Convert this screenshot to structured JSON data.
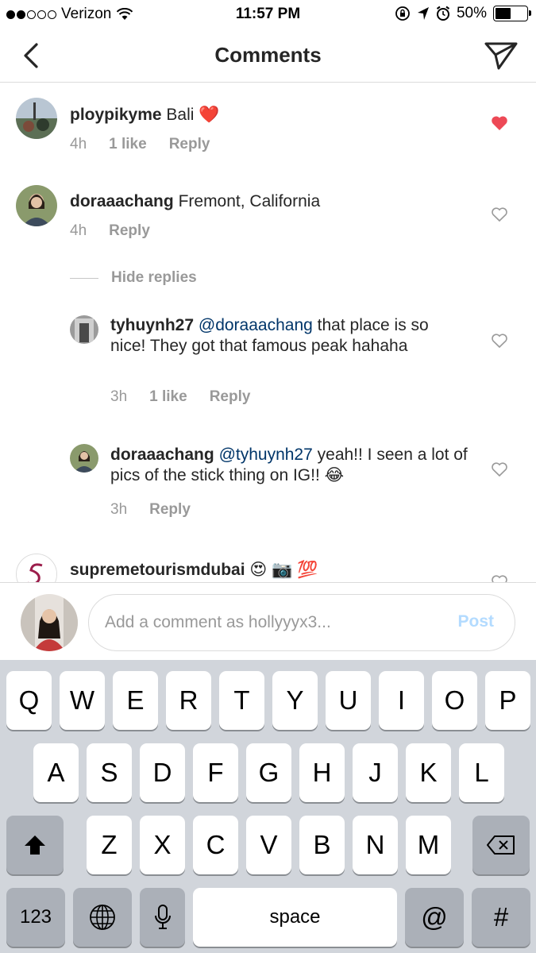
{
  "status": {
    "carrier": "Verizon",
    "time": "11:57 PM",
    "battery": "50%",
    "battery_level": 0.5
  },
  "nav": {
    "title": "Comments",
    "back_icon": "chevron-left-icon",
    "share_icon": "paper-plane-icon"
  },
  "comments": [
    {
      "user": "ploypikyme",
      "text": "Bali ❤️",
      "time": "4h",
      "likes": "1 like",
      "reply": "Reply",
      "liked": true
    },
    {
      "user": "doraaachang",
      "text": "Fremont, California",
      "time": "4h",
      "reply": "Reply",
      "liked": false
    },
    {
      "user": "supremetourismdubai",
      "text": "😍 📷 💯"
    }
  ],
  "hide_replies": "Hide replies",
  "replies": [
    {
      "user": "tyhuynh27",
      "mention": "@doraaachang",
      "text": "that place is so nice! They got that famous peak hahaha",
      "time": "3h",
      "likes": "1 like",
      "reply": "Reply"
    },
    {
      "user": "doraaachang",
      "mention": "@tyhuynh27",
      "text": "yeah!! I seen a lot of pics of the stick thing on IG!! 😂",
      "time": "3h",
      "reply": "Reply"
    }
  ],
  "input": {
    "placeholder": "Add a comment as hollyyyx3...",
    "post": "Post"
  },
  "keyboard": {
    "row1": [
      "Q",
      "W",
      "E",
      "R",
      "T",
      "Y",
      "U",
      "I",
      "O",
      "P"
    ],
    "row2": [
      "A",
      "S",
      "D",
      "F",
      "G",
      "H",
      "J",
      "K",
      "L"
    ],
    "row3": [
      "Z",
      "X",
      "C",
      "V",
      "B",
      "N",
      "M"
    ],
    "numbers": "123",
    "space": "space",
    "at": "@",
    "hash": "#"
  },
  "colors": {
    "like_red": "#ed4956",
    "mention_blue": "#003569",
    "post_blue": "#b3dbff"
  }
}
